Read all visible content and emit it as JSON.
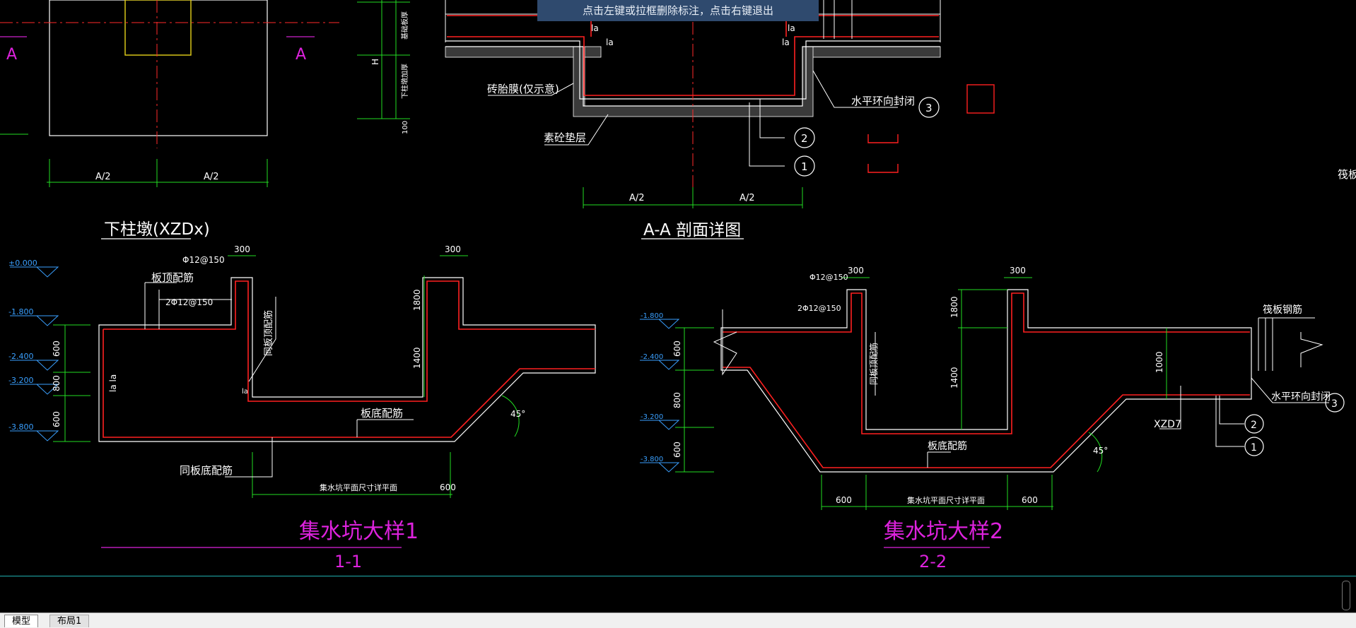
{
  "hint_bar": {
    "text": "点击左键或拉框删除标注，点击右键退出"
  },
  "tabs": [
    {
      "label": "模型"
    },
    {
      "label": "布局1"
    }
  ],
  "colors": {
    "bg": "#000000",
    "wall": "#ff2020",
    "dim": "#22dd22",
    "title": "#dd22dd",
    "text": "#ffffff",
    "hint_bg": "#2f4a6e",
    "elev": "#3aa0ff"
  },
  "drawing": {
    "pier": {
      "mark_left": "A",
      "mark_right": "A",
      "dim_left": "A/2",
      "dim_right": "A/2",
      "title": "下柱墩(XZDx)"
    },
    "pier_side_labels": {
      "h": "H",
      "top": "基础板厚",
      "mid": "下柱墩加厚",
      "bottom": "100"
    },
    "section_aa": {
      "labels": {
        "brick": "砖胎膜(仅示意)",
        "bedding": "素砼垫层",
        "seal": "水平环向封闭",
        "la1": "la",
        "la2": "la",
        "la3": "la",
        "la4": "la"
      },
      "callouts": [
        "1",
        "2",
        "3"
      ],
      "dim_left": "A/2",
      "dim_right": "A/2",
      "title": "A-A 剖面详图"
    },
    "right_edge_label": "筏板",
    "pit1": {
      "elevations": [
        "±0.000",
        "-1.800",
        "-2.400",
        "-3.200",
        "-3.800"
      ],
      "dim_300a": "300",
      "dim_300b": "300",
      "bar_top": "Φ12@150",
      "bar_top2": "2Φ12@150",
      "slab_top_rebar": "板顶配筋",
      "same_top": "同板顶配筋",
      "dim_1800": "1800",
      "dim_1400": "1400",
      "left_dims": [
        "600",
        "800",
        "600"
      ],
      "slab_bottom_rebar": "板底配筋",
      "same_bottom": "同板底配筋",
      "la_left": "la la",
      "la_small": "la",
      "angle": "45°",
      "plan_dim": "集水坑平面尺寸详平面",
      "dim_600": "600",
      "title": "集水坑大样1",
      "subtitle": "1-1"
    },
    "pit2": {
      "elevations": [
        "-1.800",
        "-2.400",
        "-3.200",
        "-3.800"
      ],
      "dim_300a": "300",
      "dim_300b": "300",
      "bar_top": "Φ12@150",
      "bar_top2": "2Φ12@150",
      "same_top": "同板顶配筋",
      "raft_rebar": "筏板钢筋",
      "dim_1800": "1800",
      "dim_1400": "1400",
      "dim_1000": "1000",
      "left_dims": [
        "600",
        "800",
        "600"
      ],
      "slab_bottom_rebar": "板底配筋",
      "seal": "水平环向封闭",
      "xzd": "XZD7",
      "callouts": [
        "3",
        "2",
        "1"
      ],
      "angle": "45°",
      "dim_600a": "600",
      "plan_dim": "集水坑平面尺寸详平面",
      "dim_600b": "600",
      "title": "集水坑大样2",
      "subtitle": "2-2"
    }
  }
}
